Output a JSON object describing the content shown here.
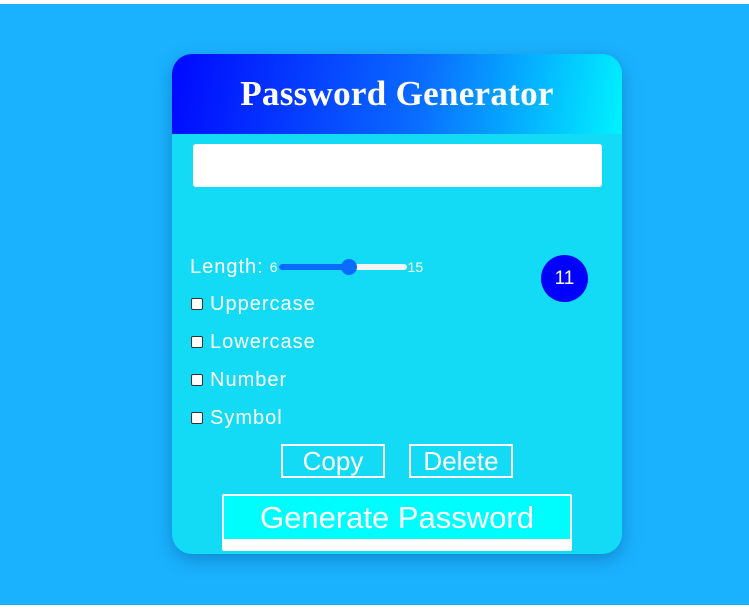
{
  "app": {
    "title": "Password Generator"
  },
  "password": {
    "value": "",
    "placeholder": ""
  },
  "length": {
    "label": "Length:",
    "min": "6",
    "max": "15",
    "current": "11"
  },
  "options": [
    {
      "label": "Uppercase",
      "checked": false
    },
    {
      "label": "Lowercase",
      "checked": false
    },
    {
      "label": "Number",
      "checked": false
    },
    {
      "label": "Symbol",
      "checked": false
    }
  ],
  "actions": {
    "copy_label": "Copy",
    "delete_label": "Delete",
    "generate_label": "Generate Password"
  },
  "colors": {
    "background": "#1ab2ff",
    "card": "#13dbf5",
    "header_start": "#0008ff",
    "header_end": "#00f2ff",
    "badge": "#0000ff",
    "generate_button": "#00fdfd",
    "slider_accent": "#0a6cff"
  }
}
